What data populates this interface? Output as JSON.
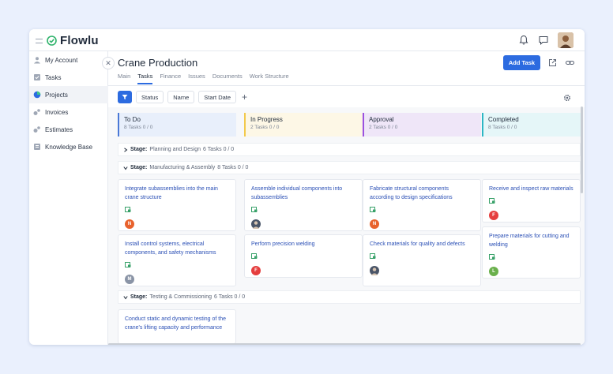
{
  "app": {
    "title": "Flowlu"
  },
  "sidebar": {
    "items": [
      {
        "label": "My Account",
        "icon": "user-icon"
      },
      {
        "label": "Tasks",
        "icon": "tasks-icon"
      },
      {
        "label": "Projects",
        "icon": "projects-icon",
        "active": true
      },
      {
        "label": "Invoices",
        "icon": "invoice-icon"
      },
      {
        "label": "Estimates",
        "icon": "estimate-icon"
      },
      {
        "label": "Knowledge Base",
        "icon": "knowledge-icon"
      }
    ]
  },
  "header": {
    "project_title": "Crane Production",
    "add_task_label": "Add Task"
  },
  "tabs": [
    "Main",
    "Tasks",
    "Finance",
    "Issues",
    "Documents",
    "Work Structure"
  ],
  "active_tab": "Tasks",
  "filters": {
    "status": "Status",
    "name": "Name",
    "start_date": "Start Date",
    "add": "+"
  },
  "columns": [
    {
      "name": "To Do",
      "meta": "8 Tasks   0 / 0",
      "color": "#4a78d6",
      "bg": "#e8effb"
    },
    {
      "name": "In Progress",
      "meta": "2 Tasks   0 / 0",
      "color": "#f2c94c",
      "bg": "#fdf7e6"
    },
    {
      "name": "Approval",
      "meta": "2 Tasks   0 / 0",
      "color": "#9b51e0",
      "bg": "#efe6f8"
    },
    {
      "name": "Completed",
      "meta": "8 Tasks   0 / 0",
      "color": "#2bb5c4",
      "bg": "#e5f6f8"
    }
  ],
  "stages": [
    {
      "prefix": "Stage:",
      "name": "Planning and Design",
      "meta": "6 Tasks 0 / 0",
      "expanded": false
    },
    {
      "prefix": "Stage:",
      "name": "Manufacturing & Assembly",
      "meta": "8 Tasks 0 / 0",
      "expanded": true
    },
    {
      "prefix": "Stage:",
      "name": "Testing & Commissioning",
      "meta": "6 Tasks 0 / 0",
      "expanded": true
    }
  ],
  "cards": [
    {
      "title": "Integrate subassemblies into the main crane structure",
      "avatar": "N",
      "avatar_color": "#e8622c"
    },
    {
      "title": "Assemble individual components into subassemblies",
      "avatar": "",
      "avatar_color": "#4a5568"
    },
    {
      "title": "Fabricate structural components according to design specifications",
      "avatar": "N",
      "avatar_color": "#e8622c"
    },
    {
      "title": "Receive and inspect raw materials",
      "avatar": "F",
      "avatar_color": "#e53e3e"
    },
    {
      "title": "Install control systems, electrical components, and safety mechanisms",
      "avatar": "M",
      "avatar_color": "#8a94a6"
    },
    {
      "title": "Perform precision welding",
      "avatar": "F",
      "avatar_color": "#e53e3e"
    },
    {
      "title": "Check materials for quality and defects",
      "avatar": "",
      "avatar_color": "#4a5568"
    },
    {
      "title": "Prepare materials for cutting and welding",
      "avatar": "L",
      "avatar_color": "#6ab04c"
    },
    {
      "title": "Conduct static and dynamic testing of the crane's lifting capacity and performance",
      "avatar": "",
      "avatar_color": ""
    }
  ],
  "colors": {
    "accent": "#2c6be0",
    "card_title": "#2a4fb5",
    "doc_icon": "#38a169"
  }
}
